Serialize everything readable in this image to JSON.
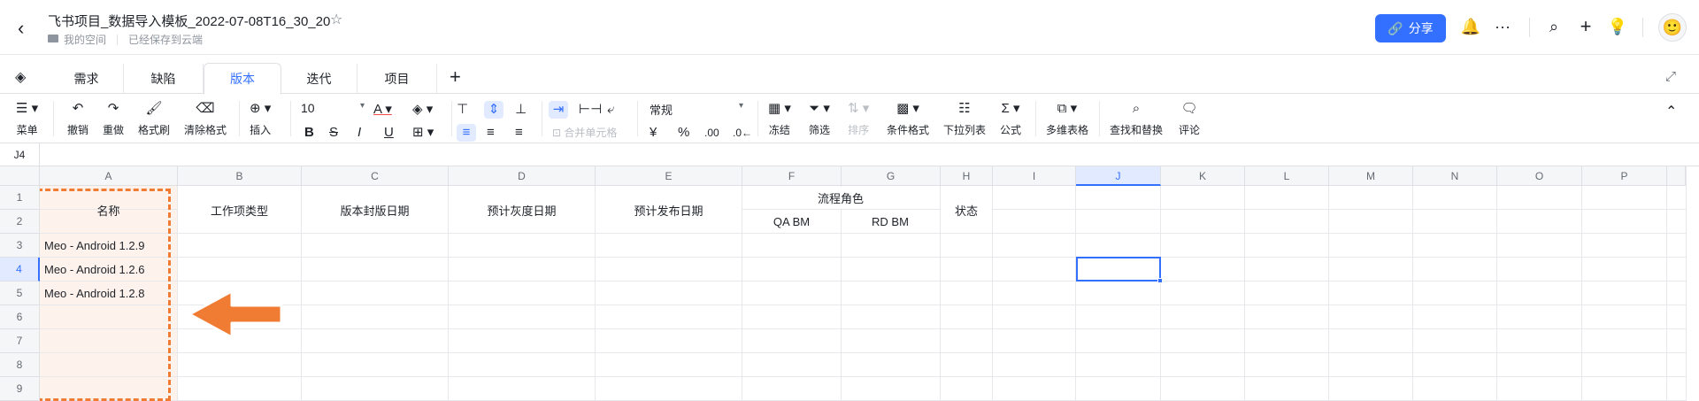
{
  "header": {
    "doc_title": "飞书项目_数据导入模板_2022-07-08T16_30_20",
    "breadcrumb_space": "我的空间",
    "save_status": "已经保存到云端",
    "share_label": "分享"
  },
  "tabs": [
    {
      "label": "需求"
    },
    {
      "label": "缺陷"
    },
    {
      "label": "版本",
      "active": true
    },
    {
      "label": "迭代"
    },
    {
      "label": "项目"
    }
  ],
  "toolbar": {
    "menu": "菜单",
    "undo": "撤销",
    "redo": "重做",
    "format_painter": "格式刷",
    "clear_format": "清除格式",
    "insert": "插入",
    "font_size": "10",
    "merge_cells": "合并单元格",
    "number_format": "常规",
    "currency_symbol": "¥",
    "percent_symbol": "%",
    "decimal_increase": ".00",
    "freeze": "冻结",
    "filter": "筛选",
    "sort": "排序",
    "conditional_format": "条件格式",
    "dropdown_list": "下拉列表",
    "formula": "公式",
    "multi_sheet": "多维表格",
    "find_replace": "查找和替换",
    "comment": "评论"
  },
  "formula_bar": {
    "cell_ref": "J4"
  },
  "grid": {
    "columns": [
      "A",
      "B",
      "C",
      "D",
      "E",
      "F",
      "G",
      "H",
      "I",
      "J",
      "K",
      "L",
      "M",
      "N",
      "O",
      "P"
    ],
    "rows": [
      "1",
      "2",
      "3",
      "4",
      "5",
      "6",
      "7",
      "8",
      "9"
    ],
    "selected_column": "J",
    "selected_row": "4",
    "headers": {
      "name": "名称",
      "work_item_type": "工作项类型",
      "release_seal_date": "版本封版日期",
      "gray_date": "预计灰度日期",
      "publish_date": "预计发布日期",
      "process_role": "流程角色",
      "qa_bm": "QA BM",
      "rd_bm": "RD BM",
      "status": "状态"
    },
    "names": [
      "Meo - Android 1.2.9",
      "Meo - Android 1.2.6",
      "Meo - Android 1.2.8"
    ]
  },
  "colors": {
    "accent": "#3370ff",
    "highlight_orange": "#f07c33",
    "highlight_bg": "#fdf2ec"
  }
}
